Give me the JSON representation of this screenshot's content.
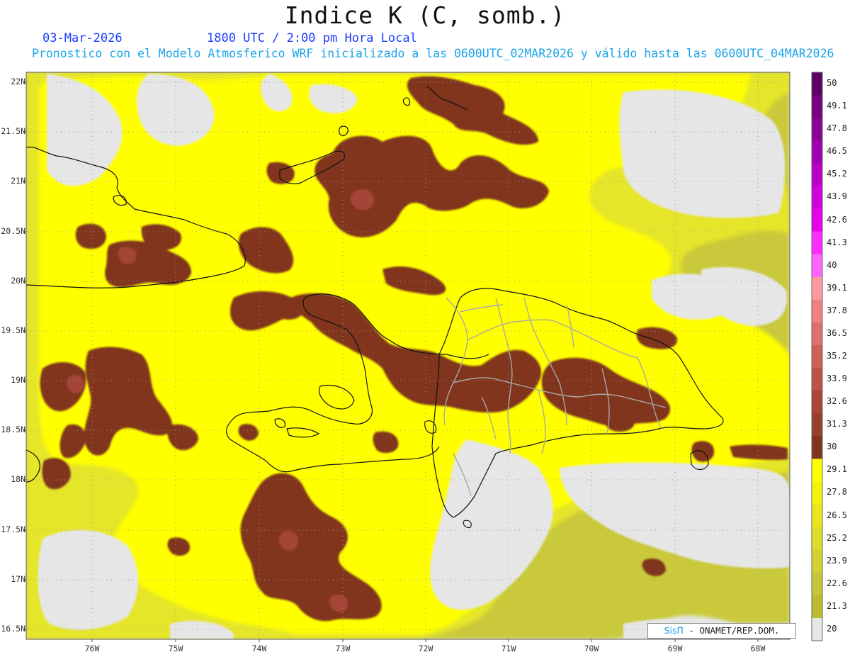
{
  "header": {
    "title": "Indice K (C, somb.)",
    "date": "03-Mar-2026",
    "time": "1800 UTC / 2:00 pm Hora Local",
    "description": "Pronostico con el Modelo Atmosferico WRF inicializado a las 0600UTC_02MAR2026 y válido hasta las  0600UTC_04MAR2026"
  },
  "map": {
    "lat_labels": [
      "22N",
      "21.5N",
      "21N",
      "20.5N",
      "20N",
      "19.5N",
      "19N",
      "18.5N",
      "18N",
      "17.5N",
      "17N",
      "16.5N"
    ],
    "lon_labels": [
      "76W",
      "75W",
      "74W",
      "73W",
      "72W",
      "71W",
      "70W",
      "69W",
      "68W"
    ],
    "credit_logo": "SisΠ",
    "credit_text": " - ONAMET/REP.DOM."
  },
  "colorbar": {
    "levels": [
      "50",
      "49.1",
      "47.8",
      "46.5",
      "45.2",
      "43.9",
      "42.6",
      "41.3",
      "40",
      "39.1",
      "37.8",
      "36.5",
      "35.2",
      "33.9",
      "32.6",
      "31.3",
      "30",
      "29.1",
      "27.8",
      "26.5",
      "25.2",
      "23.9",
      "22.6",
      "21.3",
      "20"
    ],
    "colors": [
      "#5c0066",
      "#74007e",
      "#8a0096",
      "#a100b0",
      "#ba00c8",
      "#d100dc",
      "#e800ea",
      "#ff2cff",
      "#ff64ff",
      "#ff9aa0",
      "#f28080",
      "#e07070",
      "#cf6058",
      "#bf5248",
      "#a9463a",
      "#97402e",
      "#80341f",
      "#ffff00",
      "#f5f30c",
      "#e8e81c",
      "#dddd2a",
      "#d2d232",
      "#c6c63a",
      "#bbbb2c",
      "#e6e6e6"
    ],
    "key_colors": {
      "no_data": "#e6e6e6",
      "low": "#bbbb2c",
      "mid": "#e8e81c",
      "high": "#ffff00",
      "instability": "#80341f",
      "strong": "#a9463a"
    }
  }
}
